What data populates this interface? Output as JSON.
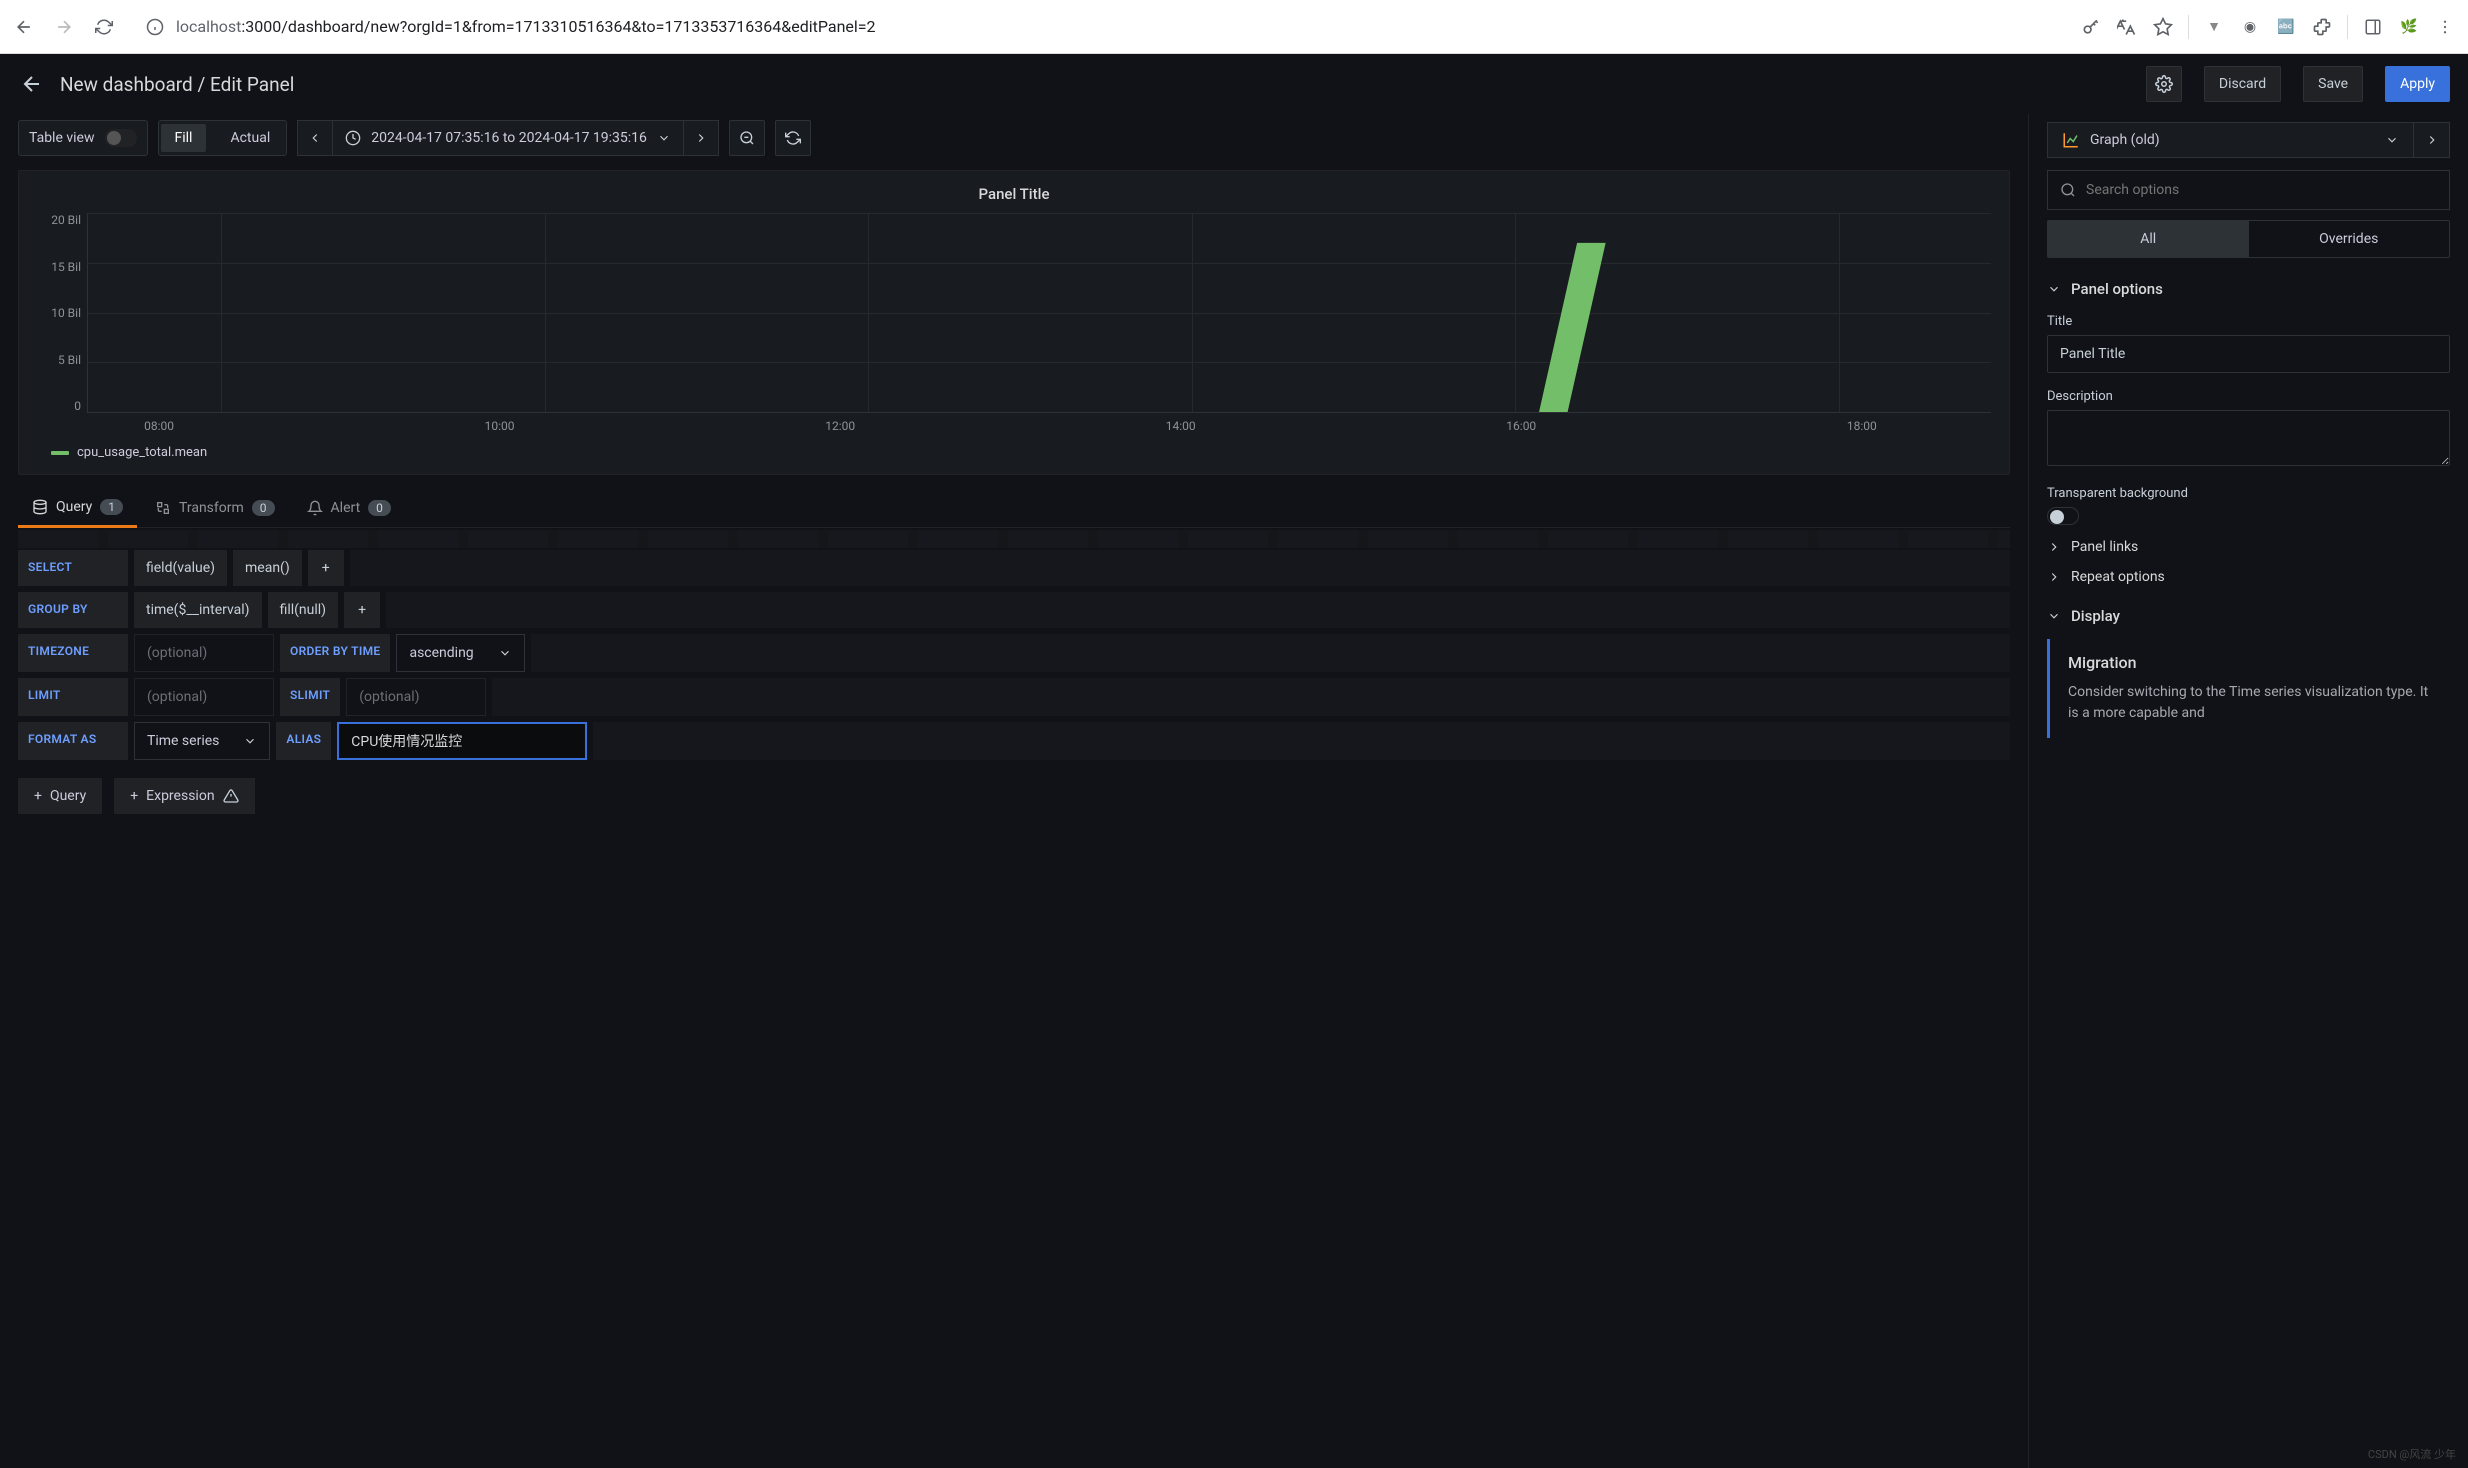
{
  "browser": {
    "url_host_dim": "localhost",
    "url_rest": ":3000/dashboard/new?orgId=1&from=1713310516364&to=1713353716364&editPanel=2"
  },
  "header": {
    "breadcrumb": "New dashboard / Edit Panel",
    "discard": "Discard",
    "save": "Save",
    "apply": "Apply"
  },
  "toolbar": {
    "table_view": "Table view",
    "fill": "Fill",
    "actual": "Actual",
    "time_range": "2024-04-17 07:35:16 to 2024-04-17 19:35:16"
  },
  "panel": {
    "title": "Panel Title",
    "legend": "cpu_usage_total.mean"
  },
  "chart_data": {
    "type": "line",
    "title": "Panel Title",
    "xlabel": "",
    "ylabel": "",
    "ylim": [
      0,
      20000000000
    ],
    "x_ticks": [
      "08:00",
      "10:00",
      "12:00",
      "14:00",
      "16:00",
      "18:00"
    ],
    "y_ticks": [
      "0",
      "5 Bil",
      "10 Bil",
      "15 Bil",
      "20 Bil"
    ],
    "series": [
      {
        "name": "cpu_usage_total.mean",
        "color": "#73bf69",
        "x": [
          "16:20",
          "16:40"
        ],
        "values": [
          0,
          17000000000
        ]
      }
    ]
  },
  "tabs": {
    "query": "Query",
    "query_count": "1",
    "transform": "Transform",
    "transform_count": "0",
    "alert": "Alert",
    "alert_count": "0"
  },
  "query": {
    "select": "SELECT",
    "field_value": "field(value)",
    "mean": "mean()",
    "group_by": "GROUP BY",
    "time_interval": "time($__interval)",
    "fill_null": "fill(null)",
    "timezone": "TIMEZONE",
    "optional": "(optional)",
    "order_by_time": "ORDER BY TIME",
    "ascending": "ascending",
    "limit": "LIMIT",
    "slimit": "SLIMIT",
    "format_as": "FORMAT AS",
    "time_series": "Time series",
    "alias": "ALIAS",
    "alias_value": "CPU使用情况监控",
    "add_query": "Query",
    "add_expression": "Expression"
  },
  "right": {
    "viz_type": "Graph (old)",
    "search_placeholder": "Search options",
    "tab_all": "All",
    "tab_overrides": "Overrides",
    "panel_options": "Panel options",
    "title_label": "Title",
    "title_value": "Panel Title",
    "description_label": "Description",
    "transparent_bg": "Transparent background",
    "panel_links": "Panel links",
    "repeat_options": "Repeat options",
    "display": "Display",
    "migration_title": "Migration",
    "migration_body": "Consider switching to the Time series visualization type. It is a more capable and"
  },
  "watermark": "CSDN @风流 少年"
}
